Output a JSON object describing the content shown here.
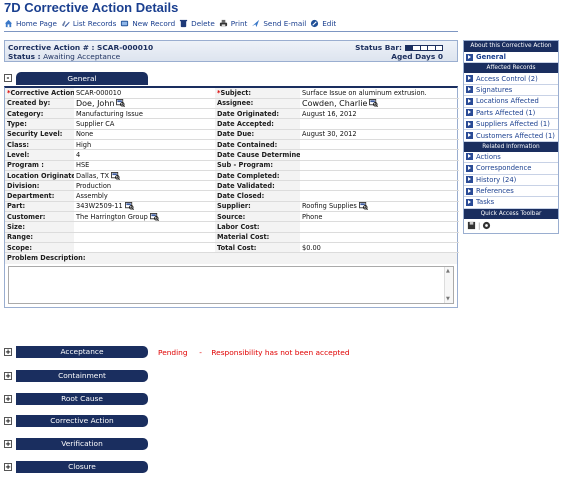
{
  "header": {
    "title": "7D Corrective Action Details"
  },
  "toolbar": [
    {
      "label": "Home Page",
      "icon": "home-icon"
    },
    {
      "label": "List Records",
      "icon": "list-icon"
    },
    {
      "label": "New Record",
      "icon": "new-record-icon"
    },
    {
      "label": "Delete",
      "icon": "delete-icon"
    },
    {
      "label": "Print",
      "icon": "print-icon"
    },
    {
      "label": "Send E-mail",
      "icon": "email-icon"
    },
    {
      "label": "Edit",
      "icon": "edit-icon"
    }
  ],
  "record": {
    "ca_label": "Corrective Action # :",
    "ca_number": "SCAR-000010",
    "status_label": "Status :",
    "status_value": "Awaiting Acceptance",
    "status_bar_label": "Status Bar:",
    "status_bar_filled": 1,
    "status_bar_total": 5,
    "aged_label": "Aged Days",
    "aged_value": "0"
  },
  "general": {
    "tab": "General",
    "toggle": "-",
    "rows": [
      {
        "l1": "Corrective Action #:",
        "r1": true,
        "v1": "SCAR-000010",
        "l2": "Subject:",
        "r2": true,
        "v2": "Surface Issue on aluminum extrusion."
      },
      {
        "l1": "Created by:",
        "v1": "Doe, John",
        "v1big": true,
        "lk1": true,
        "l2": "Assignee:",
        "v2": "Cowden, Charlie",
        "v2big": true,
        "lk2": true
      },
      {
        "l1": "Category:",
        "v1": "Manufacturing Issue",
        "l2": "Date Originated:",
        "v2": "August 16, 2012"
      },
      {
        "l1": "Type:",
        "v1": "Supplier CA",
        "l2": "Date Accepted:",
        "v2": ""
      },
      {
        "l1": "Security Level:",
        "v1": "None",
        "l2": "Date Due:",
        "v2": "August 30, 2012"
      },
      {
        "l1": "Class:",
        "v1": "High",
        "l2": "Date Contained:",
        "v2": ""
      },
      {
        "l1": "Level:",
        "v1": "4",
        "l2": "Date Cause Determined:",
        "v2": ""
      },
      {
        "l1": "Program :",
        "v1": "HSE",
        "l2": "Sub - Program:",
        "v2": ""
      },
      {
        "l1": "Location Originated:",
        "v1": "Dallas, TX",
        "lk1": true,
        "l2": "Date Completed:",
        "v2": ""
      },
      {
        "l1": "Division:",
        "v1": "Production",
        "l2": "Date Validated:",
        "v2": ""
      },
      {
        "l1": "Department:",
        "v1": "Assembly",
        "l2": "Date Closed:",
        "v2": ""
      },
      {
        "l1": "Part:",
        "v1": "343W2509-11",
        "lk1": true,
        "l2": "Supplier:",
        "v2": "Roofing Supplies",
        "lk2": true
      },
      {
        "l1": "Customer:",
        "v1": "The Harrington Group",
        "lk1": true,
        "l2": "Source:",
        "v2": "Phone"
      },
      {
        "l1": "Size:",
        "v1": "",
        "l2": "Labor Cost:",
        "v2": ""
      },
      {
        "l1": "Range:",
        "v1": "",
        "l2": "Material Cost:",
        "v2": ""
      },
      {
        "l1": "Scope:",
        "v1": "",
        "l2": "Total Cost:",
        "v2": "$0.00"
      }
    ],
    "problem_label": "Problem Description:",
    "problem_value": ""
  },
  "sections": [
    {
      "tab": "Acceptance",
      "toggle": "+",
      "pending": "Pending     -    Responsibility has not been accepted"
    },
    {
      "tab": "Containment",
      "toggle": "+"
    },
    {
      "tab": "Root Cause",
      "toggle": "+"
    },
    {
      "tab": "Corrective Action",
      "toggle": "+"
    },
    {
      "tab": "Verification",
      "toggle": "+"
    },
    {
      "tab": "Closure",
      "toggle": "+"
    }
  ],
  "sidebar": {
    "title": "About this Corrective Action",
    "general": "General",
    "affected_header": "Affected Records",
    "affected": [
      "Access Control (2)",
      "Signatures",
      "Locations Affected",
      "Parts Affected (1)",
      "Suppliers Affected (1)",
      "Customers Affected (1)"
    ],
    "related_header": "Related Information",
    "related": [
      "Actions",
      "Correspondence",
      "History (24)",
      "References",
      "Tasks"
    ],
    "qa_header": "Quick Access Toolbar"
  },
  "colors": {
    "navy": "#1a2e5f",
    "link": "#1a3f8f",
    "pending": "#e00000"
  }
}
